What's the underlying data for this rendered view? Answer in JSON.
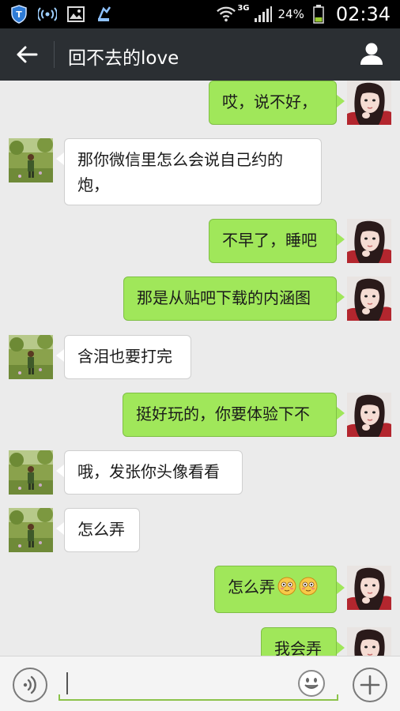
{
  "status_bar": {
    "network": "3G",
    "battery": "24%",
    "time": "02:34"
  },
  "header": {
    "title": "回不去的love"
  },
  "messages": [
    {
      "from": "me",
      "text": "哎，说不好，"
    },
    {
      "from": "them",
      "lines": [
        "那你微信里怎么会说自己约的",
        "炮，"
      ]
    },
    {
      "from": "me",
      "text": "不早了，睡吧"
    },
    {
      "from": "me",
      "text": "那是从贴吧下载的内涵图"
    },
    {
      "from": "them",
      "text": "含泪也要打完"
    },
    {
      "from": "me",
      "text": "挺好玩的，你要体验下不"
    },
    {
      "from": "them",
      "text": "哦，发张你头像看看"
    },
    {
      "from": "them",
      "text": "怎么弄"
    },
    {
      "from": "me",
      "text": "怎么弄",
      "emojis": [
        "flushed-face-icon",
        "flushed-face-icon"
      ]
    },
    {
      "from": "me",
      "text": "我会弄"
    }
  ],
  "colors": {
    "my_bubble": "#a0e75a",
    "their_bubble": "#ffffff",
    "title_bar": "#2b2f33",
    "input_underline": "#8bc34a"
  }
}
